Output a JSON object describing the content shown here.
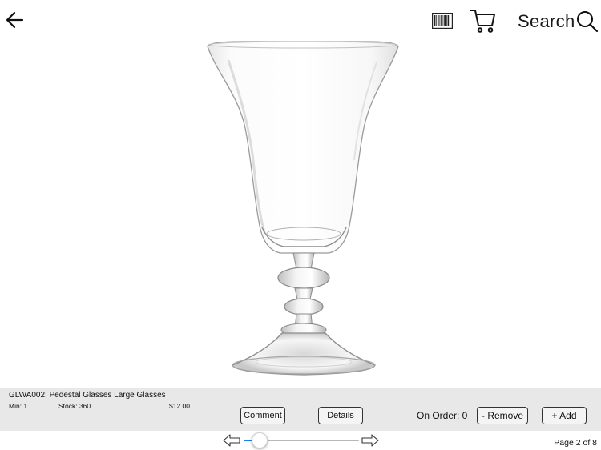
{
  "header": {
    "back_icon": "arrow-left-icon",
    "barcode_icon": "barcode-icon",
    "cart_icon": "cart-icon",
    "search_label": "Search",
    "search_icon": "magnifier-icon"
  },
  "product": {
    "title": "GLWA002: Pedestal Glasses Large Glasses",
    "min": "Min: 1",
    "stock": "Stock: 360",
    "price": "$12.00"
  },
  "actions": {
    "comment_label": "Comment",
    "details_label": "Details",
    "on_order": "On Order: 0",
    "remove_label": "- Remove",
    "add_label": "+ Add"
  },
  "pager": {
    "prev_icon": "arrow-left-outline-icon",
    "next_icon": "arrow-right-outline-icon",
    "current_page": 2,
    "total_pages": 8,
    "page_text": "Page 2 of 8",
    "slider_value": 0.14
  },
  "colors": {
    "panel_bg": "#e8e8e8",
    "slider_accent": "#1e7cf2"
  }
}
